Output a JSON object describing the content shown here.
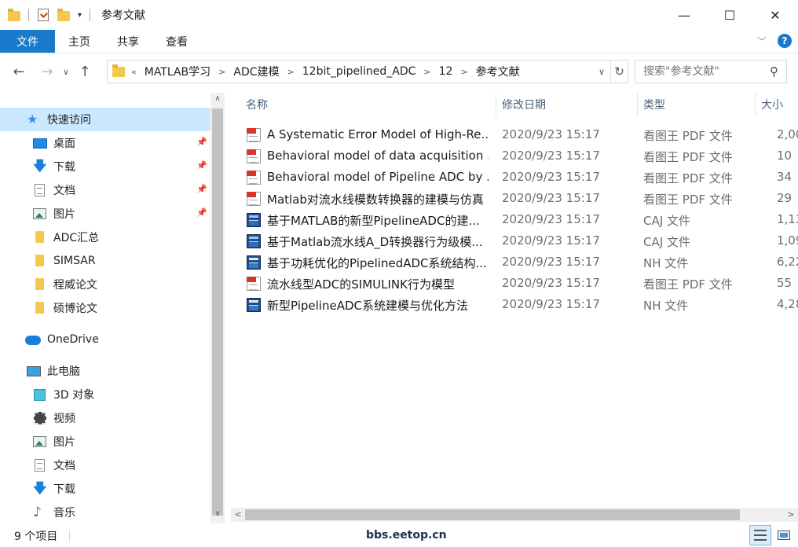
{
  "window": {
    "title": "参考文献",
    "minimize": "—",
    "maximize": "☐",
    "close": "✕"
  },
  "ribbon": {
    "tabs": [
      "文件",
      "主页",
      "共享",
      "查看"
    ]
  },
  "address": {
    "prefix": "«",
    "crumbs": [
      "MATLAB学习",
      "ADC建模",
      "12bit_pipelined_ADC",
      "12",
      "参考文献"
    ]
  },
  "search": {
    "placeholder": "搜索\"参考文献\""
  },
  "nav": {
    "quick_access": "快速访问",
    "items": [
      {
        "label": "桌面",
        "icon": "desktop-icon"
      },
      {
        "label": "下载",
        "icon": "download-icon"
      },
      {
        "label": "文档",
        "icon": "document-icon"
      },
      {
        "label": "图片",
        "icon": "pictures-icon"
      },
      {
        "label": "ADC汇总",
        "icon": "folder-icon"
      },
      {
        "label": "SIMSAR",
        "icon": "folder-icon"
      },
      {
        "label": "程威论文",
        "icon": "folder-icon"
      },
      {
        "label": "硕博论文",
        "icon": "folder-icon"
      }
    ],
    "onedrive": "OneDrive",
    "this_pc": "此电脑",
    "pc_items": [
      {
        "label": "3D 对象",
        "icon": "3d-objects-icon"
      },
      {
        "label": "视频",
        "icon": "videos-icon"
      },
      {
        "label": "图片",
        "icon": "pictures-icon"
      },
      {
        "label": "文档",
        "icon": "document-icon"
      },
      {
        "label": "下载",
        "icon": "download-icon"
      },
      {
        "label": "音乐",
        "icon": "music-icon"
      }
    ]
  },
  "columns": {
    "name": "名称",
    "date": "修改日期",
    "type": "类型",
    "size": "大小"
  },
  "files": [
    {
      "name": "A Systematic Error Model of High-Re...",
      "date": "2020/9/23 15:17",
      "type": "看图王 PDF 文件",
      "size": "2,00",
      "icon": "pdf"
    },
    {
      "name": "Behavioral model of data acquisition ...",
      "date": "2020/9/23 15:17",
      "type": "看图王 PDF 文件",
      "size": "10",
      "icon": "pdf"
    },
    {
      "name": "Behavioral model of Pipeline ADC by ...",
      "date": "2020/9/23 15:17",
      "type": "看图王 PDF 文件",
      "size": "34",
      "icon": "pdf"
    },
    {
      "name": "Matlab对流水线模数转换器的建模与仿真",
      "date": "2020/9/23 15:17",
      "type": "看图王 PDF 文件",
      "size": "29",
      "icon": "pdf"
    },
    {
      "name": "基于MATLAB的新型PipelineADC的建...",
      "date": "2020/9/23 15:17",
      "type": "CAJ 文件",
      "size": "1,13",
      "icon": "caj"
    },
    {
      "name": "基于Matlab流水线A_D转换器行为级模...",
      "date": "2020/9/23 15:17",
      "type": "CAJ 文件",
      "size": "1,09",
      "icon": "caj"
    },
    {
      "name": "基于功耗优化的PipelinedADC系统结构...",
      "date": "2020/9/23 15:17",
      "type": "NH 文件",
      "size": "6,22",
      "icon": "nh"
    },
    {
      "name": "流水线型ADC的SIMULINK行为模型",
      "date": "2020/9/23 15:17",
      "type": "看图王 PDF 文件",
      "size": "55",
      "icon": "pdf"
    },
    {
      "name": "新型PipelineADC系统建模与优化方法",
      "date": "2020/9/23 15:17",
      "type": "NH 文件",
      "size": "4,28",
      "icon": "nh"
    }
  ],
  "status": {
    "count": "9 个项目",
    "watermark": "bbs.eetop.cn"
  }
}
